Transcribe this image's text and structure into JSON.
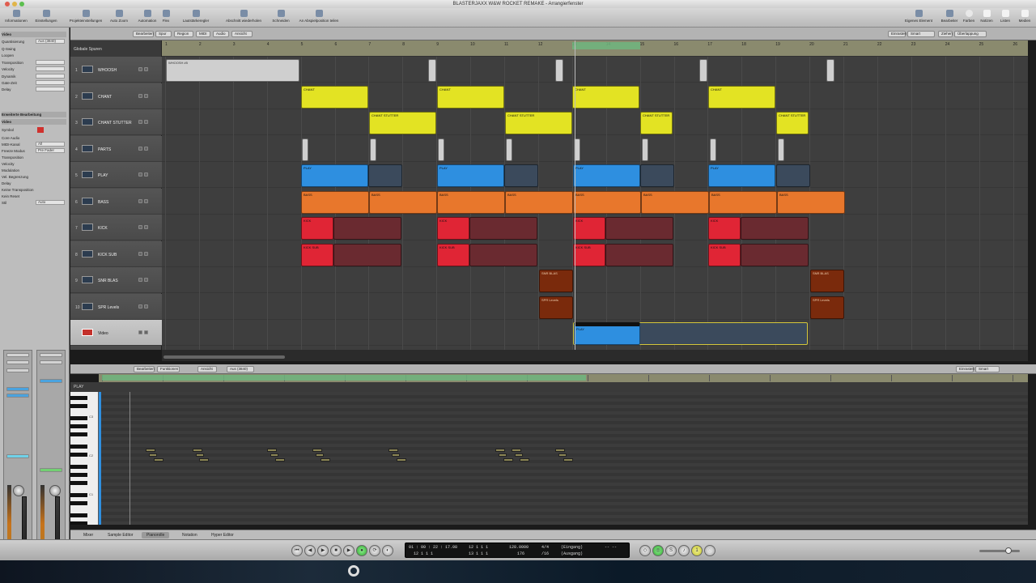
{
  "window": {
    "title": "BLASTERJAXX W&W ROCKET REMAKE - Arrangierfenster"
  },
  "toolbar": {
    "left": [
      "Informationen",
      "Einstellungen",
      "Projekteinstellungen",
      "Auto Zoom",
      "Automation",
      "Flex",
      "Lautstärkeregler",
      "Abschnitt wiederholen",
      "Schneiden",
      "An Abspielposition teilen"
    ],
    "right": [
      "Eigenes Element",
      "Bearbeiter",
      "Farben",
      "Notizen",
      "Listen",
      "Medien"
    ]
  },
  "inspector": {
    "header": "Video",
    "rows": [
      {
        "label": "Quantisierung",
        "value": "Aus (3840)"
      },
      {
        "label": "Q-Swing",
        "value": ""
      },
      {
        "label": "Loopen",
        "value": ""
      },
      {
        "label": "Transposition",
        "value": ""
      },
      {
        "label": "Velocity",
        "value": ""
      },
      {
        "label": "Dynamik",
        "value": ""
      },
      {
        "label": "Gate-Zeit",
        "value": ""
      },
      {
        "label": "Delay",
        "value": ""
      }
    ],
    "section2": "Erweiterte Bearbeitung",
    "section3": "Video",
    "rows2": [
      {
        "label": "Symbol",
        "value": ""
      },
      {
        "label": "Core Audio",
        "value": ""
      },
      {
        "label": "MIDI-Kanal",
        "value": "All"
      },
      {
        "label": "Freeze Modus",
        "value": "Pre Fader"
      },
      {
        "label": "Transposition",
        "value": ""
      },
      {
        "label": "Velocity",
        "value": ""
      },
      {
        "label": "Modulation",
        "value": ""
      },
      {
        "label": "Vel. Begrenzung",
        "value": ""
      },
      {
        "label": "Delay",
        "value": ""
      },
      {
        "label": "Keine Transposition",
        "value": ""
      },
      {
        "label": "Kein Reset",
        "value": ""
      },
      {
        "label": "Stil",
        "value": "Auto"
      }
    ],
    "strips": [
      {
        "name": "Video",
        "bottom": "Video"
      },
      {
        "name": "Stereo",
        "bottom": "Output"
      }
    ]
  },
  "arrange": {
    "toolbar_menus": [
      "Bearbeiten",
      "Spur",
      "Region",
      "MIDI",
      "Audio",
      "Ansicht"
    ],
    "right_menus": [
      "Einrasten",
      "Smart",
      "Ziehen",
      "Überlappung"
    ],
    "global_tracks_label": "Globale Spuren",
    "bar_numbers": [
      "1",
      "2",
      "3",
      "4",
      "5",
      "6",
      "7",
      "8",
      "9",
      "10",
      "11",
      "12",
      "13",
      "14",
      "15",
      "16",
      "17",
      "18",
      "19",
      "20",
      "21",
      "22",
      "23",
      "24",
      "25",
      "26"
    ],
    "tracks": [
      {
        "num": "1",
        "name": "WHOOSH"
      },
      {
        "num": "2",
        "name": "CHANT"
      },
      {
        "num": "3",
        "name": "CHANT STUTTER"
      },
      {
        "num": "4",
        "name": "PARTS"
      },
      {
        "num": "5",
        "name": "PLAY"
      },
      {
        "num": "6",
        "name": "BASS"
      },
      {
        "num": "7",
        "name": "KICK"
      },
      {
        "num": "8",
        "name": "KICK SUB"
      },
      {
        "num": "9",
        "name": "SNR BLAS"
      },
      {
        "num": "10",
        "name": "SPR Levels"
      },
      {
        "num": "",
        "name": "Video"
      }
    ],
    "region_labels": {
      "whoosh": "WHOOSH #5",
      "chant": "CHANT",
      "stutter": "CHANT STUTTER",
      "play": "PLAY",
      "bass": "BASS",
      "kick": "KICK",
      "kicksub": "KICK SUB",
      "snr": "SNR BLAS",
      "spr": "SPR Levels",
      "video": "PLAY"
    }
  },
  "piano_roll": {
    "toolbar_menus": [
      "Bearbeiten",
      "Funktionen",
      "Ansicht",
      "Aus (3840)"
    ],
    "right_info": [
      "Raster",
      "Einrasten",
      "Smart"
    ],
    "region_label": "PLAY",
    "key_labels": [
      "C3",
      "C2",
      "C1"
    ]
  },
  "bottom_tabs": [
    "Mixer",
    "Sample Editor",
    "Pianorolle",
    "Notation",
    "Hyper Editor"
  ],
  "transport": {
    "lcd": {
      "smpte": "01 : 00 : 22 : 17.08",
      "bars": "12  1  1  1",
      "bars2": "13  1  1  1",
      "tempo": "128.0000",
      "sig": "4/4",
      "sig2": "/16",
      "in": "(Eingang)",
      "out": "(Ausgang)",
      "cpu": "-- --",
      "div": "176"
    }
  },
  "colors": {
    "yellow": "#e3e323",
    "blue": "#2e8fe0",
    "orange": "#e8772c",
    "red": "#e02535",
    "brown": "#7a2a0c",
    "grey": "#cfcfcf"
  }
}
